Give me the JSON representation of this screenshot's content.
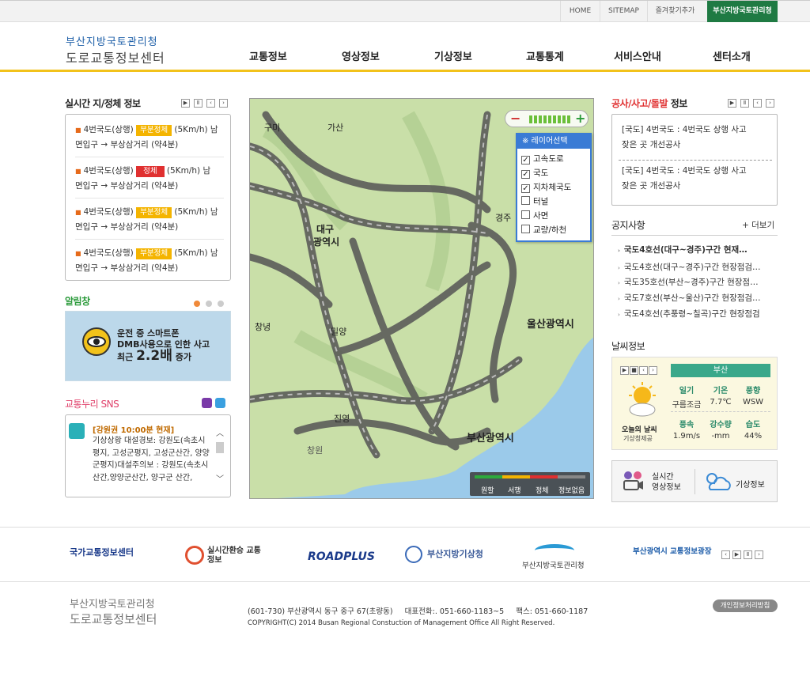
{
  "util_nav": [
    "HOME",
    "SITEMAP",
    "즐겨찾기추가",
    "부산지방국토관리청"
  ],
  "logo": {
    "line1": "부산지방국토관리청",
    "line2": "도로교통정보센터"
  },
  "gnb": [
    "교통정보",
    "영상정보",
    "기상정보",
    "교통통계",
    "서비스안내",
    "센터소개"
  ],
  "traffic": {
    "title": "실시간 지/정체 정보",
    "items": [
      {
        "road": "4번국도(상행)",
        "status": "부분정체",
        "speed": "(5Km/h) 남",
        "route": "면입구 → 부상삼거리 (약4분)",
        "type": "slow"
      },
      {
        "road": "4번국도(상행)",
        "status": "정체",
        "speed": "(5Km/h) 남",
        "route": "면입구 → 부상삼거리 (약4분)",
        "type": "jam"
      },
      {
        "road": "4번국도(상행)",
        "status": "부분정체",
        "speed": "(5Km/h) 남",
        "route": "면입구 → 부상삼거리 (약4분)",
        "type": "slow"
      },
      {
        "road": "4번국도(상행)",
        "status": "부분정체",
        "speed": "(5Km/h) 남",
        "route": "면입구 → 부상삼거리 (약4분)",
        "type": "slow"
      }
    ]
  },
  "alert": {
    "title": "알림창",
    "line1": "운전 중 스마트폰",
    "line2": "DMB사용으로 인한 사고",
    "line3a": "최근",
    "line3b": "2.2배",
    "line3c": "증가"
  },
  "sns": {
    "title": "교통누리 SNS",
    "head": "[강원권 10:00분 현재]",
    "body": "기상상황 대설경보: 강원도(속초시평지, 고성군평지, 고성군산간, 양양군평지)대설주의보 : 강원도(속초시 산간,양양군산간, 양구군 산간,"
  },
  "map": {
    "layer_title": "※ 레이어선택",
    "layers": [
      {
        "label": "고속도로",
        "checked": true
      },
      {
        "label": "국도",
        "checked": true
      },
      {
        "label": "지차체국도",
        "checked": true
      },
      {
        "label": "터널",
        "checked": false
      },
      {
        "label": "사면",
        "checked": false
      },
      {
        "label": "교량/하천",
        "checked": false
      }
    ],
    "cities": [
      "구미",
      "가산",
      "대구",
      "광역시",
      "경주",
      "울산광역시",
      "창녕",
      "밀양",
      "진영",
      "창원",
      "부산광역시"
    ],
    "legend": [
      "원할",
      "서행",
      "정체",
      "정보없음"
    ],
    "legend_colors": [
      "#2eaa3c",
      "#f4b400",
      "#e03030",
      "#888888"
    ]
  },
  "incident": {
    "title_red": "공사/사고/돌발",
    "title_rest": " 정보",
    "items": [
      {
        "line1": "[국도] 4번국도 : 4번국도 상행 사고",
        "line2": "잦은 곳 개선공사"
      },
      {
        "line1": "[국도] 4번국도 : 4번국도 상행 사고",
        "line2": "잦은 곳 개선공사"
      }
    ]
  },
  "notice": {
    "title": "공지사항",
    "more": "+ 더보기",
    "items": [
      "국도4호선(대구~경주)구간 현재…",
      "국도4호선(대구~경주)구간 현장점검…",
      "국도35호선(부산~경주)구간 현장점…",
      "국도7호선(부산~울산)구간 현장점검…",
      "국도4호선(추풍령~칠곡)구간 현장점검"
    ]
  },
  "weather": {
    "title": "날씨정보",
    "city": "부산",
    "today": "오늘의 날씨",
    "source": "기상청제공",
    "h1": [
      "일기",
      "기온",
      "풍향"
    ],
    "v1": [
      "구름조금",
      "7.7℃",
      "WSW"
    ],
    "h2": [
      "풍속",
      "강수량",
      "습도"
    ],
    "v2": [
      "1.9m/s",
      "-mm",
      "44%"
    ]
  },
  "quick": {
    "cctv": "실시간\n영상정보",
    "weather": "기상정보"
  },
  "partners": [
    "국가교통정보센터",
    "실시간환승 교통정보",
    "ROADPLUS",
    "부산지방기상청",
    "부산지방국토관리청",
    "부산광역시 교통정보광장"
  ],
  "footer": {
    "org1": "부산지방국토관리청",
    "org2": "도로교통정보센터",
    "address": "(601-730) 부산광역시 동구 중구 67(초량동)     대표전화:. 051-660-1183~5     팩스: 051-660-1187",
    "copyright": "COPYRIGHT(C) 2014 Busan Regional Constuction of Management Office  All Right Reserved.",
    "privacy": "개인정보처리방침"
  }
}
